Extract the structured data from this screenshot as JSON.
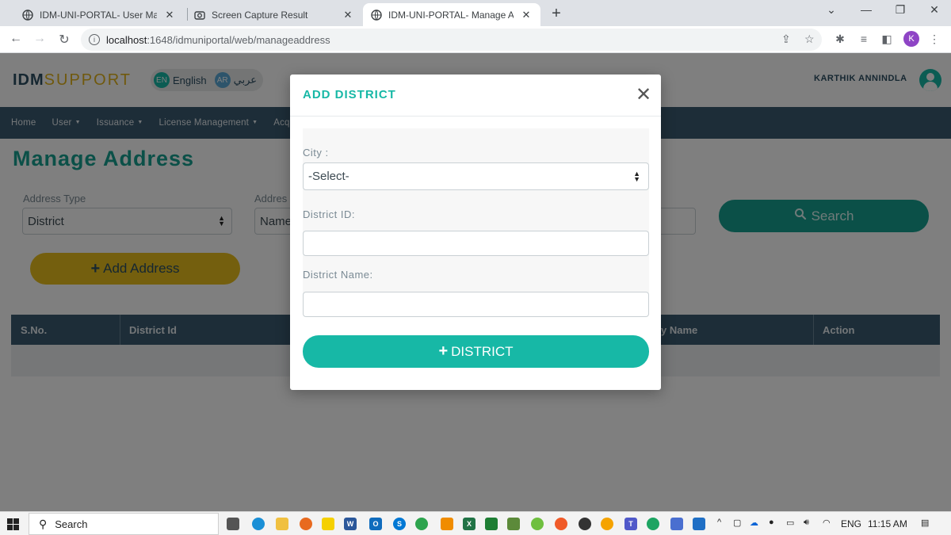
{
  "browser": {
    "tabs": [
      {
        "title": "IDM-UNI-PORTAL- User Manage",
        "close": "✕"
      },
      {
        "title": "Screen Capture Result",
        "close": "✕"
      },
      {
        "title": "IDM-UNI-PORTAL- Manage Addr",
        "close": "✕"
      }
    ],
    "new_tab": "+",
    "url_host": "localhost",
    "url_path": ":1648/idmuniportal/web/manageaddress",
    "profile_initial": "K"
  },
  "site": {
    "logo_bold": "IDM",
    "logo_light": "SUPPORT",
    "lang_en_badge": "EN",
    "lang_en_label": "English",
    "lang_ar_badge": "AR",
    "lang_ar_label": "عربي",
    "user_name": "KARTHIK ANNINDLA",
    "menu": [
      "Home",
      "User",
      "Issuance",
      "License Management",
      "Acquir"
    ]
  },
  "main": {
    "title": "Manage Address",
    "address_type_label": "Address Type",
    "address_type_value": "District",
    "address_label": "Addres",
    "address_value": "Name",
    "search_label": "Search",
    "add_address_label": "Add Address",
    "table_headers": [
      "S.No.",
      "District Id",
      "y Name",
      "Action"
    ]
  },
  "modal": {
    "title": "ADD DISTRICT",
    "close": "✕",
    "city_label": "City :",
    "city_value": "-Select-",
    "district_id_label": "District ID:",
    "district_name_label": "District Name:",
    "submit_label": "DISTRICT"
  },
  "taskbar": {
    "search_label": "Search",
    "language": "ENG",
    "time": "11:15 AM"
  },
  "colors": {
    "teal": "#17b8a6",
    "navy": "#3b5a70",
    "gold": "#e8bf1c"
  }
}
